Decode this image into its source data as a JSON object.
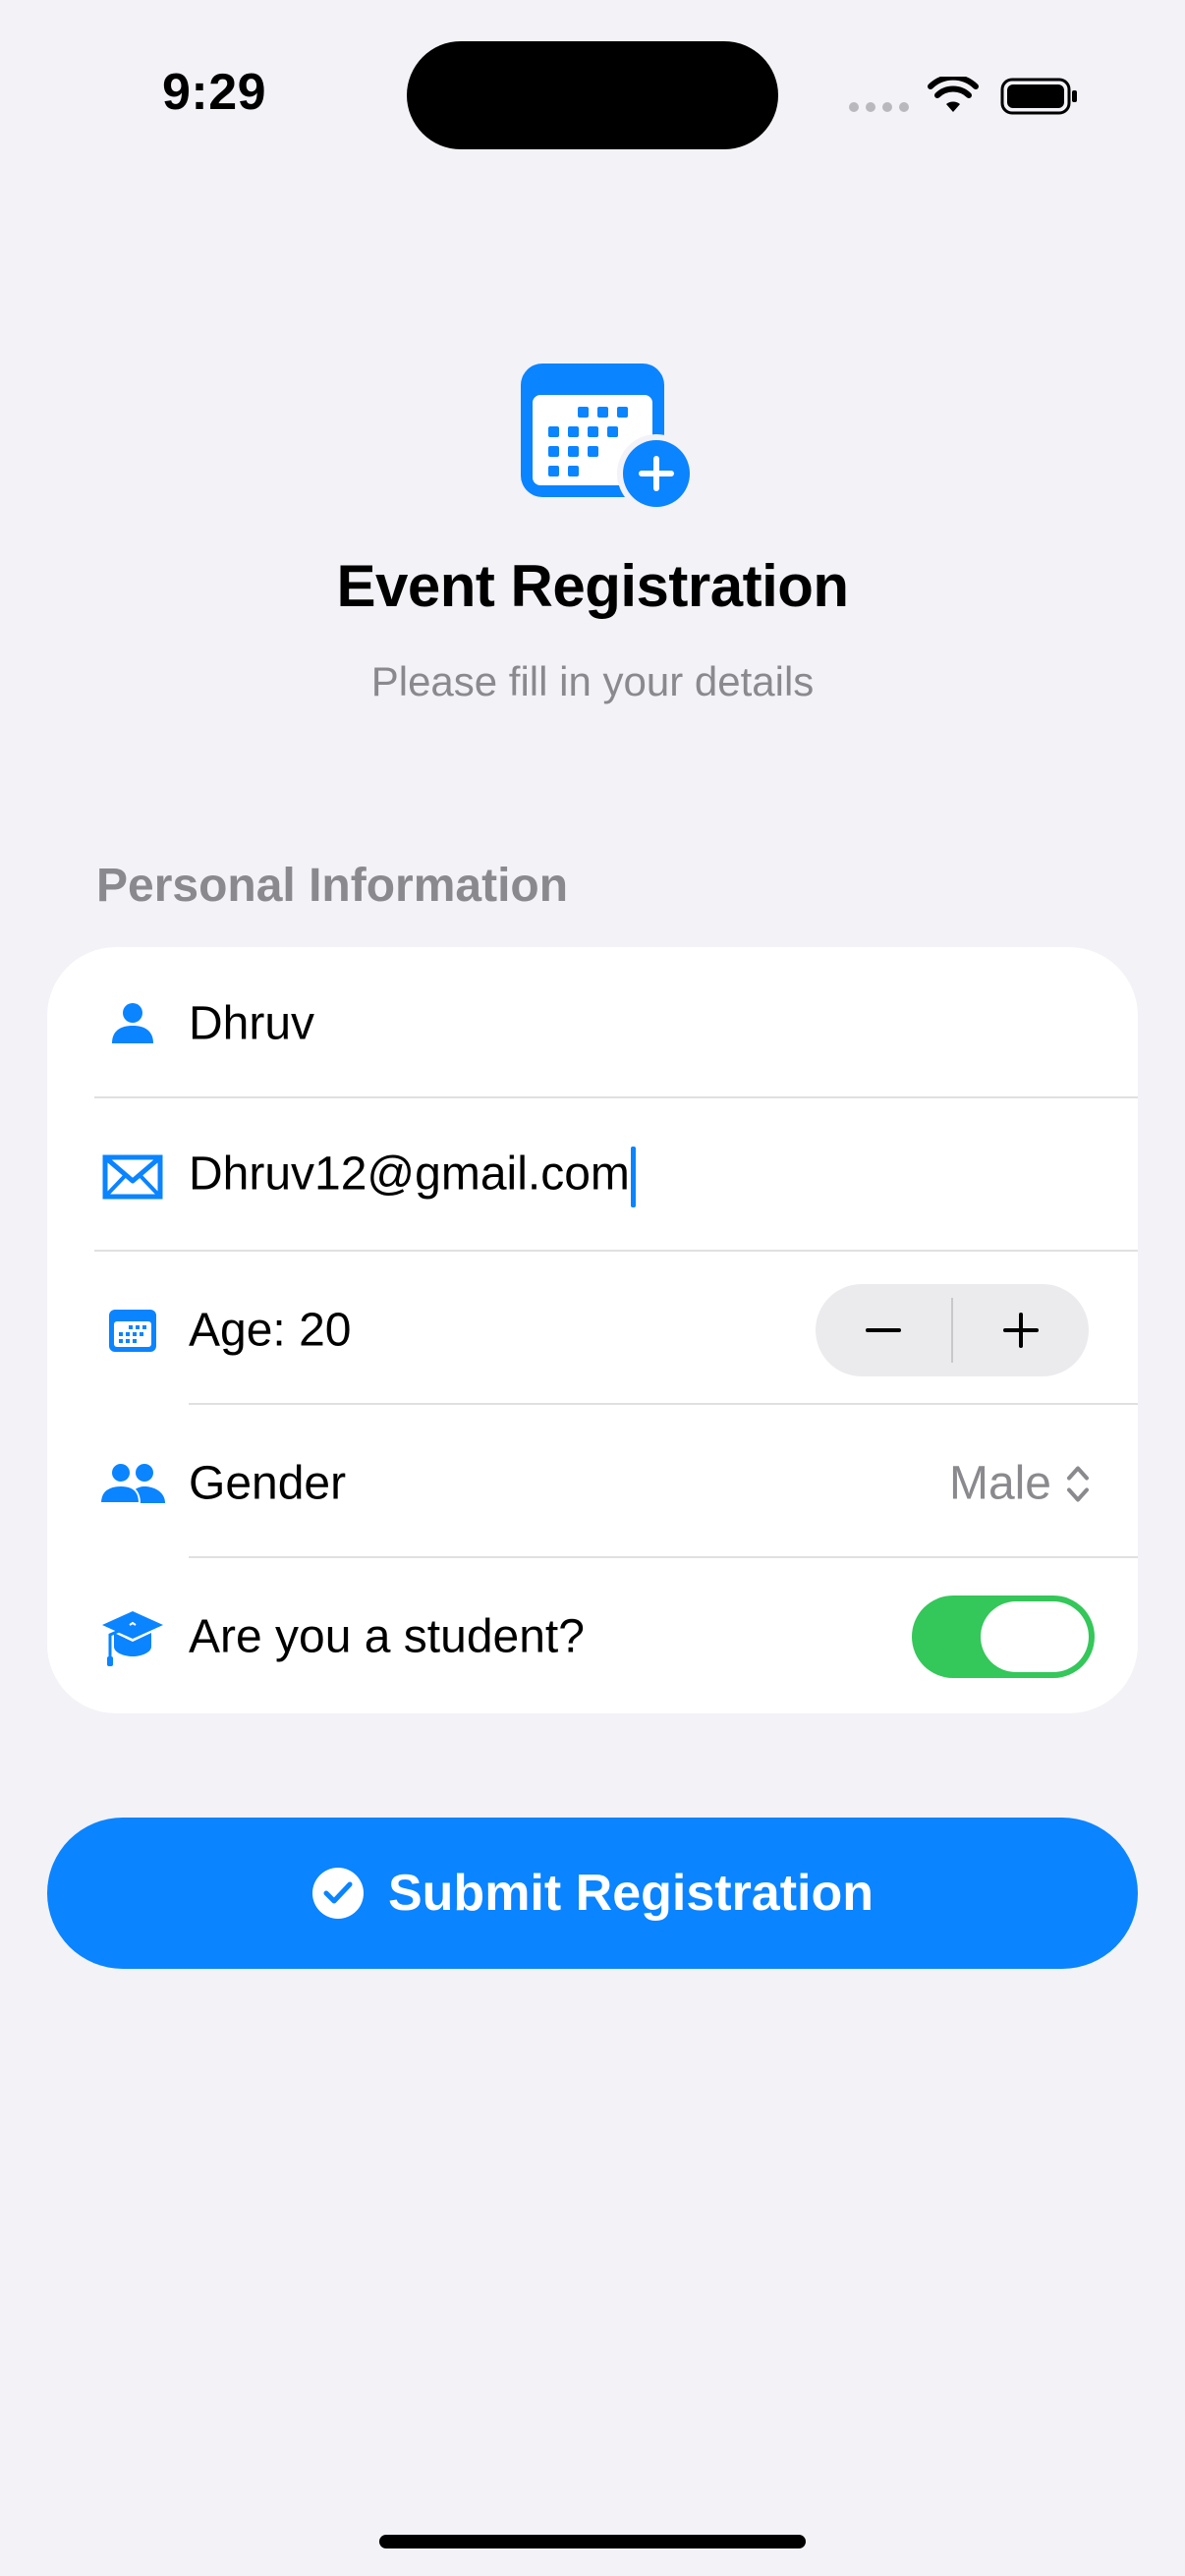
{
  "status_bar": {
    "time": "9:29"
  },
  "header": {
    "icon": "calendar-badge-plus-icon",
    "title": "Event Registration",
    "subtitle": "Please fill in your details"
  },
  "section": {
    "title": "Personal Information"
  },
  "form": {
    "name": {
      "icon": "person-icon",
      "value": "Dhruv"
    },
    "email": {
      "icon": "envelope-icon",
      "value": "Dhruv12@gmail.com"
    },
    "age": {
      "icon": "calendar-icon",
      "label": "Age: 20",
      "value": 20
    },
    "gender": {
      "icon": "people-icon",
      "label": "Gender",
      "selected": "Male"
    },
    "student": {
      "icon": "graduation-cap-icon",
      "label": "Are you a student?",
      "on": true
    }
  },
  "submit": {
    "icon": "checkmark-circle-icon",
    "label": "Submit Registration"
  },
  "colors": {
    "accent": "#0a84ff",
    "toggle_on": "#34c759",
    "background": "#f2f2f7",
    "secondary_text": "#8a8a8e"
  }
}
